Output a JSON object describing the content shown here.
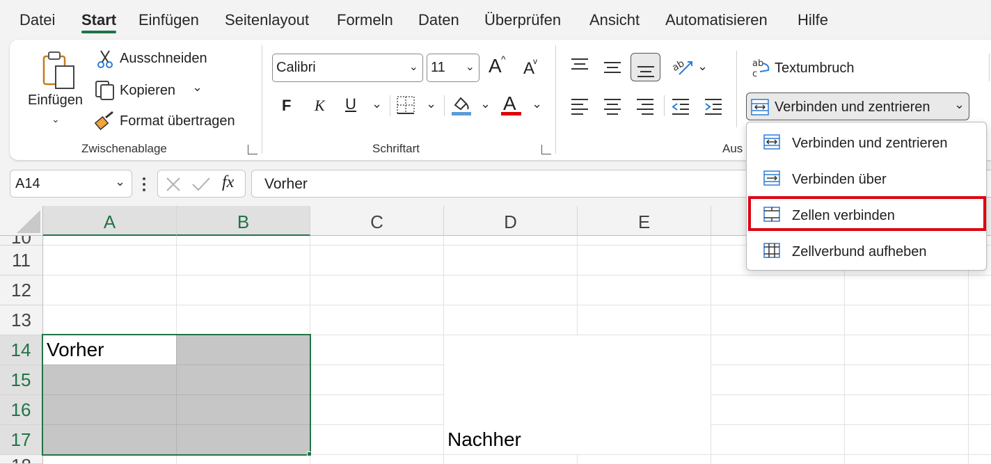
{
  "tabs": [
    "Datei",
    "Start",
    "Einfügen",
    "Seitenlayout",
    "Formeln",
    "Daten",
    "Überprüfen",
    "Ansicht",
    "Automatisieren",
    "Hilfe"
  ],
  "active_tab": "Start",
  "clipboard": {
    "paste_label": "Einfügen",
    "cut_label": "Ausschneiden",
    "copy_label": "Kopieren",
    "format_painter_label": "Format übertragen",
    "group_label": "Zwischenablage"
  },
  "font": {
    "font_name": "Calibri",
    "font_size": "11",
    "bold_label": "F",
    "italic_label": "K",
    "underline_label": "U",
    "font_color_label": "A",
    "grow_label": "A",
    "shrink_label": "A",
    "group_label": "Schriftart",
    "fill_color": "#5b9bd5",
    "font_color": "#e00000"
  },
  "alignment": {
    "wrap_text_label": "Textumbruch",
    "merge_label": "Verbinden und zentrieren",
    "group_label_partial": "Aus"
  },
  "formula_bar": {
    "name_box": "A14",
    "fx_label": "fx",
    "content": "Vorher"
  },
  "grid": {
    "columns": [
      "A",
      "B",
      "C",
      "D",
      "E"
    ],
    "rows": [
      "11",
      "12",
      "13",
      "14",
      "15",
      "16",
      "17"
    ],
    "cells": {
      "A14": "Vorher",
      "D17": "Nachher"
    }
  },
  "merge_menu": {
    "items": [
      {
        "label": "Verbinden und zentrieren"
      },
      {
        "label": "Verbinden über"
      },
      {
        "label": "Zellen verbinden",
        "highlighted": true
      },
      {
        "label": "Zellverbund aufheben"
      }
    ]
  },
  "colors": {
    "accent_green": "#217346",
    "highlight_red": "#e0000f",
    "selection_gray": "#c6c6c6"
  }
}
